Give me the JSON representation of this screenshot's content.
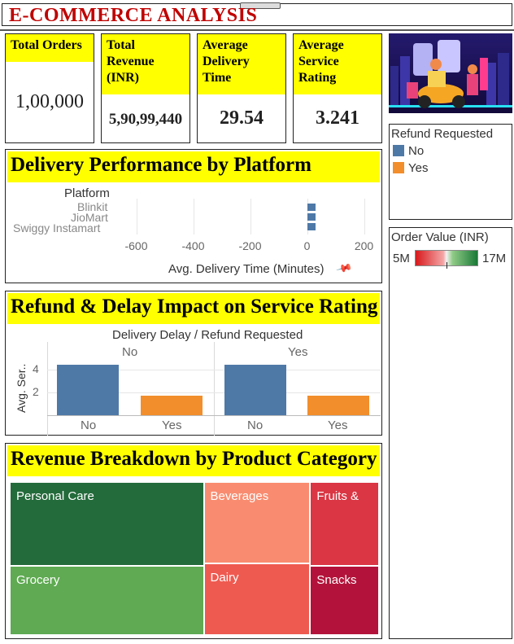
{
  "title": "E-COMMERCE ANALYSIS",
  "kpis": {
    "total_orders": {
      "label": "Total Orders",
      "value": "1,00,000"
    },
    "total_revenue": {
      "label": "Total Revenue (INR)",
      "value": "5,90,99,440"
    },
    "avg_delivery": {
      "label": "Average Delivery Time",
      "value": "29.54"
    },
    "avg_rating": {
      "label": "Average Service Rating",
      "value": "3.241"
    }
  },
  "legend_refund": {
    "title": "Refund Requested",
    "items": [
      {
        "label": "No",
        "color": "#4e79a7"
      },
      {
        "label": "Yes",
        "color": "#f28e2b"
      }
    ]
  },
  "legend_order_value": {
    "title": "Order Value (INR)",
    "min": "5M",
    "max": "17M"
  },
  "delivery_panel": {
    "title": "Delivery Performance by Platform",
    "row_header": "Platform",
    "xlabel": "Avg. Delivery Time (Minutes)"
  },
  "refund_panel": {
    "title": "Refund & Delay Impact on Service Rating",
    "col_header": "Delivery Delay  /  Refund Requested",
    "ylabel": "Avg. Ser..",
    "groups": [
      "No",
      "Yes"
    ],
    "subgroups": [
      "No",
      "Yes",
      "No",
      "Yes"
    ]
  },
  "revenue_panel": {
    "title": "Revenue Breakdown by Product Category"
  },
  "chart_data": [
    {
      "type": "bar",
      "orientation": "horizontal",
      "categories": [
        "Blinkit",
        "JioMart",
        "Swiggy Instamart"
      ],
      "values": [
        29.5,
        29.6,
        29.5
      ],
      "xlim": [
        -650,
        250
      ],
      "xticks": [
        -600,
        -400,
        -200,
        0,
        200
      ],
      "xlabel": "Avg. Delivery Time (Minutes)",
      "ylabel": "Platform",
      "color": "#4e79a7"
    },
    {
      "type": "bar",
      "groups": [
        "No",
        "Yes"
      ],
      "categories": [
        "No",
        "Yes"
      ],
      "series": [
        {
          "name": "No",
          "values": [
            4.4,
            4.4
          ],
          "color": "#4e79a7"
        },
        {
          "name": "Yes",
          "values": [
            1.7,
            1.7
          ],
          "color": "#f28e2b"
        }
      ],
      "ylim": [
        0,
        5
      ],
      "yticks": [
        2,
        4
      ],
      "ylabel": "Avg. Ser..",
      "xlabel": "Delivery Delay  /  Refund Requested"
    },
    {
      "type": "treemap",
      "items": [
        {
          "label": "Personal Care",
          "value": 17,
          "color": "#246b3b"
        },
        {
          "label": "Grocery",
          "value": 14,
          "color": "#5faa52"
        },
        {
          "label": "Beverages",
          "value": 9,
          "color": "#f98c70"
        },
        {
          "label": "Dairy",
          "value": 8,
          "color": "#ef5a50"
        },
        {
          "label": "Fruits &",
          "value": 6,
          "color": "#da3644"
        },
        {
          "label": "Snacks",
          "value": 5,
          "color": "#b3133a"
        }
      ],
      "color_range": [
        "5M",
        "17M"
      ]
    }
  ]
}
